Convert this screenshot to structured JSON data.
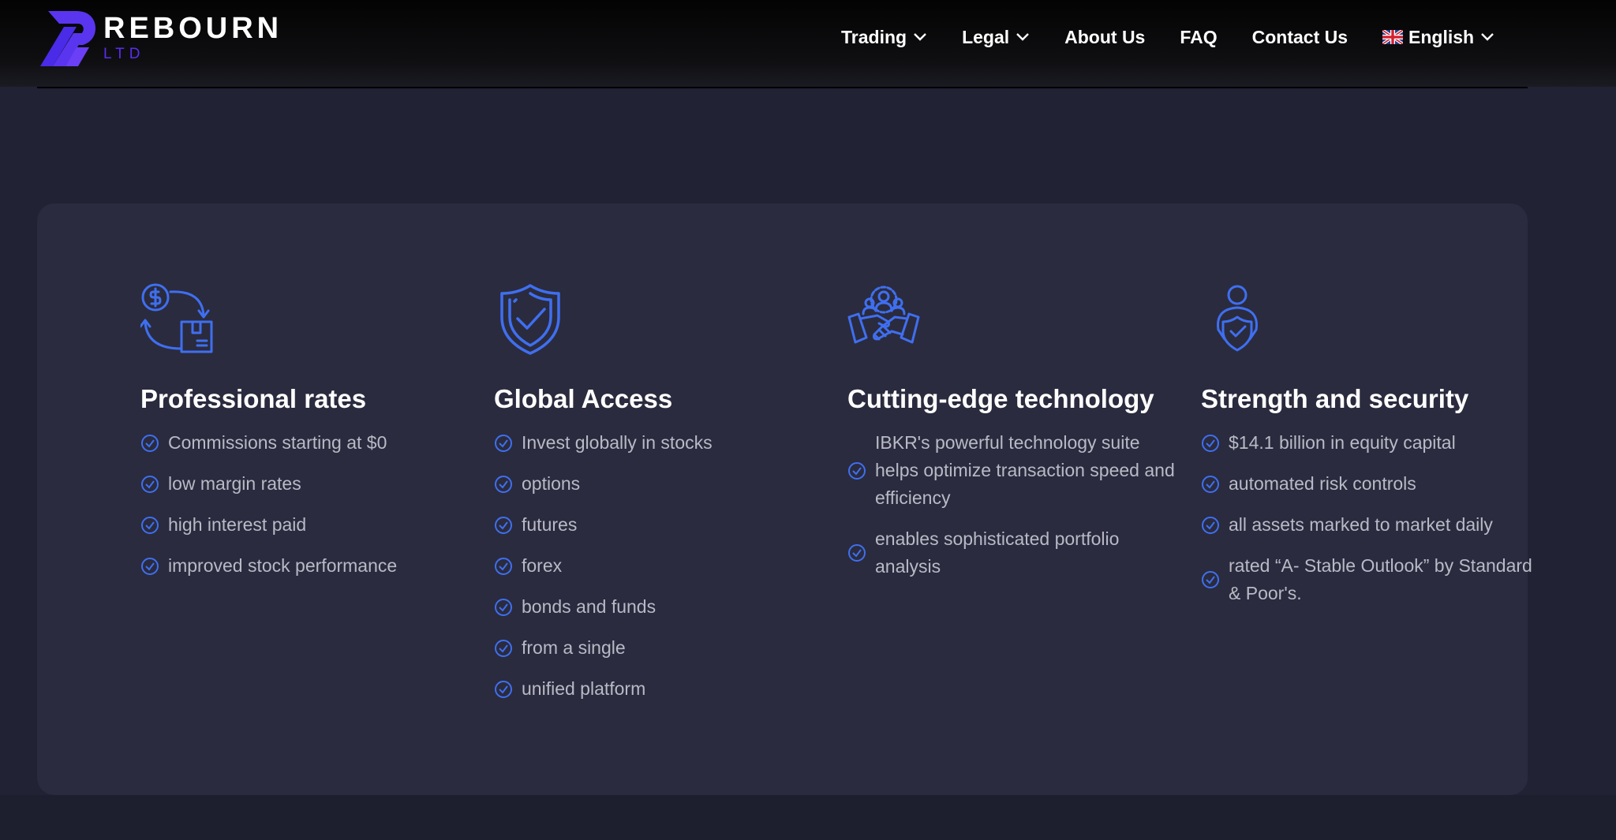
{
  "brand": {
    "name": "REBOURN",
    "suffix": "LTD",
    "accent": "#5a2df0"
  },
  "nav": {
    "items": [
      {
        "label": "Trading",
        "has_dropdown": true
      },
      {
        "label": "Legal",
        "has_dropdown": true
      },
      {
        "label": "About Us",
        "has_dropdown": false
      },
      {
        "label": "FAQ",
        "has_dropdown": false
      },
      {
        "label": "Contact Us",
        "has_dropdown": false
      }
    ],
    "language": {
      "label": "English",
      "flag": "uk-flag-icon"
    }
  },
  "colors": {
    "page_bg": "#212233",
    "card_bg": "#2a2b3e",
    "icon_blue": "#3f6ff0",
    "text_muted": "#b9bac6"
  },
  "features": [
    {
      "icon": "money-exchange-icon",
      "title": "Professional rates",
      "items": [
        "Commissions starting at $0",
        "low margin rates",
        "high interest paid",
        "improved stock performance"
      ]
    },
    {
      "icon": "shield-check-icon",
      "title": "Global Access",
      "items": [
        "Invest globally in stocks",
        "options",
        "futures",
        "forex",
        "bonds and funds",
        "from a single",
        "unified platform"
      ]
    },
    {
      "icon": "team-handshake-icon",
      "title": "Cutting-edge technology",
      "items": [
        "IBKR's powerful technology suite helps optimize transaction speed and efficiency",
        "enables sophisticated portfolio analysis"
      ]
    },
    {
      "icon": "person-shield-icon",
      "title": "Strength and security",
      "items": [
        "$14.1 billion in equity capital",
        "automated risk controls",
        "all assets marked to market daily",
        "rated “A- Stable Outlook” by Standard & Poor's."
      ]
    }
  ]
}
